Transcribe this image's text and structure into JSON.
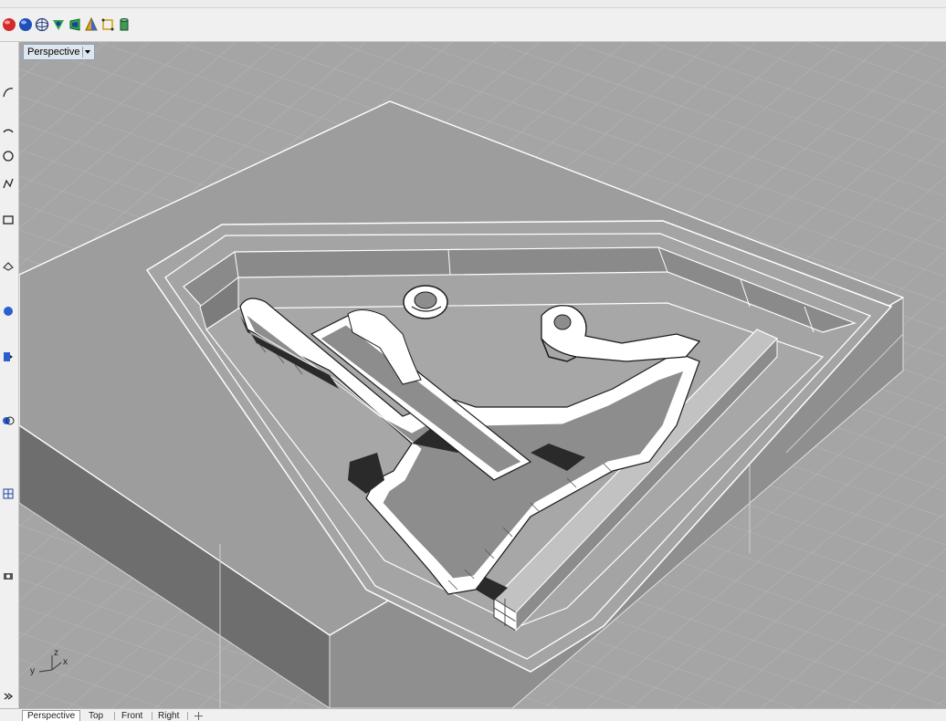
{
  "toolbar": {
    "icons": [
      "red-sphere-icon",
      "blue-sphere-icon",
      "mesh-icon",
      "shade-icon",
      "render-icon",
      "cone-icon",
      "frame-icon",
      "cylinder-icon"
    ]
  },
  "sidebar": {
    "icons": [
      "curve-tool-icon",
      "arc-tool-icon",
      "circle-tool-icon",
      "polyline-tool-icon",
      "rectangle-tool-icon",
      "surface-tool-icon",
      "solid-tool-icon",
      "transform-tool-icon",
      "boolean-tool-icon",
      "mesh-tool-icon",
      "render-tool-icon",
      "more-tools-icon"
    ]
  },
  "viewport": {
    "title": "Perspective",
    "axis_labels": {
      "x": "x",
      "y": "y",
      "z": "z"
    }
  },
  "tabs": [
    {
      "label": "Perspective",
      "active": true
    },
    {
      "label": "Top",
      "active": false
    },
    {
      "label": "Front",
      "active": false
    },
    {
      "label": "Right",
      "active": false
    }
  ],
  "colors": {
    "viewport_bg": "#a5a5a5",
    "grid": "#b7b7b7",
    "model_top": "#9c9c9c",
    "model_side": "#6f6f6f",
    "edge": "#ffffff"
  }
}
